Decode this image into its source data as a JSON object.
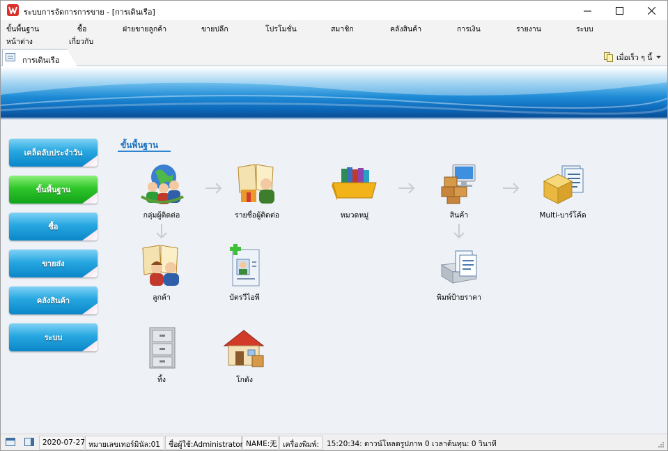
{
  "window": {
    "title": "ระบบการจัดการการขาย - [การเดินเรือ]"
  },
  "menu": [
    "ขั้นพื้นฐาน",
    "ซื้อ",
    "ฝ่ายขายลูกค้า",
    "ขายปลีก",
    "โปรโมชั่น",
    "สมาชิก",
    "คลังสินค้า",
    "การเงิน",
    "รายงาน",
    "ระบบ",
    "หน้าต่าง",
    "เกี่ยวกับ"
  ],
  "tab": {
    "label": "การเดินเรือ"
  },
  "quick": {
    "label": "เมื่อเร็ว ๆ นี้"
  },
  "sidebar": [
    {
      "label": "เคล็ดลับประจำวัน",
      "active": false
    },
    {
      "label": "ขั้นพื้นฐาน",
      "active": true
    },
    {
      "label": "ซื้อ",
      "active": false
    },
    {
      "label": "ขายส่ง",
      "active": false
    },
    {
      "label": "คลังสินค้า",
      "active": false
    },
    {
      "label": "ระบบ",
      "active": false
    }
  ],
  "section": {
    "title": "ขั้นพื้นฐาน"
  },
  "functions": [
    {
      "label": "กลุ่มผู้ติดต่อ",
      "icon": "globe-people-icon"
    },
    {
      "label": "รายชื่อผู้ติดต่อ",
      "icon": "contact-book-icon"
    },
    {
      "label": "หมวดหมู่",
      "icon": "book-category-icon"
    },
    {
      "label": "สินค้า",
      "icon": "product-computer-icon"
    },
    {
      "label": "Multi-บาร์โค้ด",
      "icon": "barcode-box-icon"
    },
    {
      "label": "ลูกค้า",
      "icon": "customer-icon"
    },
    {
      "label": "บัตรวีไอพี",
      "icon": "vip-card-icon"
    },
    {
      "label": "พิมพ์ป้ายราคา",
      "icon": "printer-icon"
    },
    {
      "label": "ทิ้ง",
      "icon": "cabinet-icon"
    },
    {
      "label": "โกดัง",
      "icon": "warehouse-icon"
    }
  ],
  "status": {
    "date": "2020-07-27",
    "terminal": "หมายเลขเทอร์มินัล:01",
    "user": "ชื่อผู้ใช้:Administrator",
    "name": "NAME:无",
    "printer": "เครื่องพิมพ์:",
    "message": "15:20:34: ดาวน์โหลดรูปภาพ 0 เวลาต้นทุน: 0 วินาที"
  },
  "colors": {
    "sidebar_blue": "#27a7e1",
    "sidebar_active": "#2fc62a",
    "accent": "#1a6fbf",
    "app_icon": "#d9322b"
  }
}
